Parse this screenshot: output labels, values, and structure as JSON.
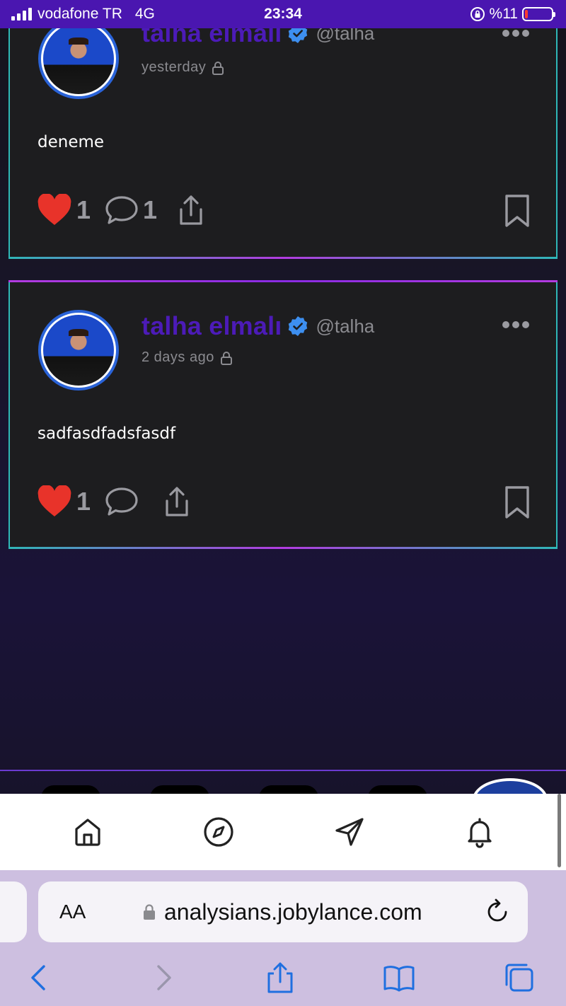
{
  "status_bar": {
    "carrier": "vodafone TR",
    "network": "4G",
    "time": "23:34",
    "battery": "%11",
    "battery_level": 0.11
  },
  "posts": [
    {
      "author": "talha elmalı",
      "handle": "@talha",
      "time": "yesterday",
      "text": "deneme",
      "likes": "1",
      "comments": "1"
    },
    {
      "author": "talha elmalı",
      "handle": "@talha",
      "time": "2 days ago",
      "text": "sadfasdfadsfasdf",
      "likes": "1",
      "comments": ""
    }
  ],
  "bottom_nav": {
    "items": [
      "home-icon",
      "compass-icon",
      "send-icon",
      "bell-icon"
    ]
  },
  "browser": {
    "text_size_label": "AA",
    "url": "analysians.jobylance.com"
  },
  "colors": {
    "status_bar": "#4a16b0",
    "author_name": "#4c1bb8",
    "card_border": "#2fb7b7",
    "like": "#e8332a",
    "browser_bar": "#cdbfe0"
  }
}
